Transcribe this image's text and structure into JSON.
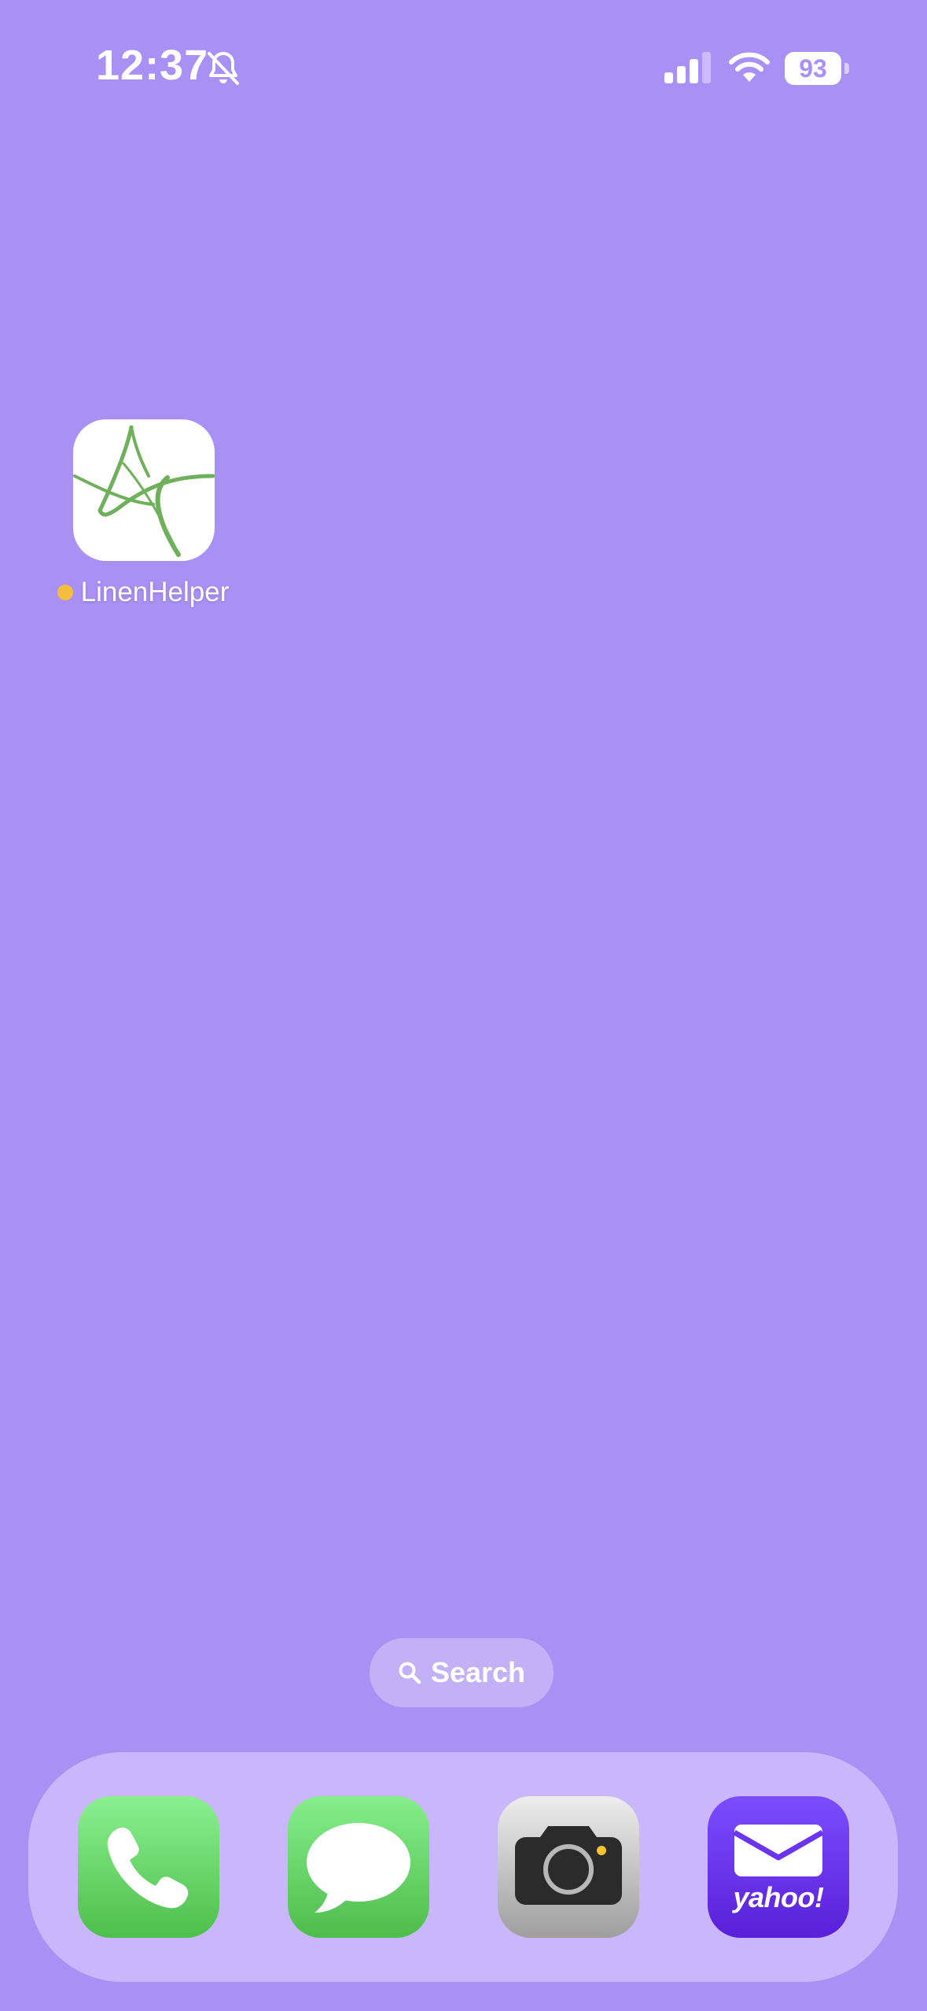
{
  "status_bar": {
    "time": "12:37",
    "battery_level": "93",
    "signal_bars_active": 3,
    "signal_bars_total": 4,
    "silent_mode_icon": "bell-slash-icon",
    "wifi_icon": "wifi-icon"
  },
  "home": {
    "apps": [
      {
        "label": "LinenHelper",
        "icon": "linenhelper-star-icon",
        "new_install_dot": true
      }
    ],
    "search_label": "Search"
  },
  "dock": {
    "apps": [
      {
        "name": "Phone",
        "icon": "phone-icon"
      },
      {
        "name": "Messages",
        "icon": "messages-icon"
      },
      {
        "name": "Camera",
        "icon": "camera-icon"
      },
      {
        "name": "Yahoo Mail",
        "icon": "yahoo-mail-icon",
        "wordmark": "yahoo!"
      }
    ]
  },
  "colors": {
    "wallpaper": "#A990F5",
    "new_dot": "#F5BD3C",
    "linenhelper_green": "#6FB05A"
  }
}
